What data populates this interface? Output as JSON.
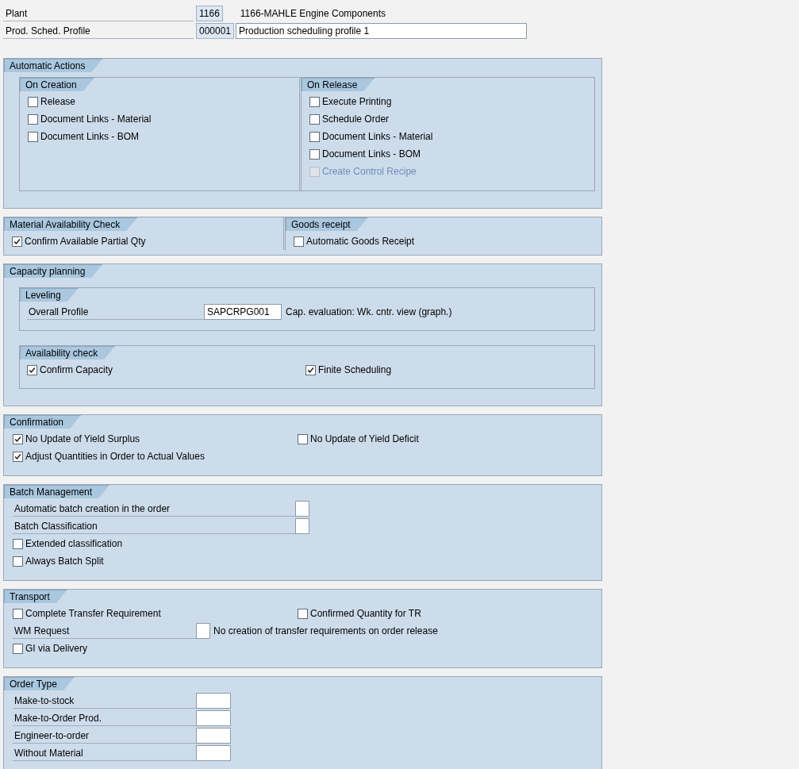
{
  "header": [
    {
      "label": "Plant",
      "value": "1166",
      "description": "1166-MAHLE Engine Components",
      "description_boxed": false
    },
    {
      "label": "Prod. Sched. Profile",
      "value": "000001",
      "description": "Production scheduling profile 1",
      "description_boxed": true
    }
  ],
  "sections": [
    {
      "title": "Automatic Actions",
      "body": [
        {
          "kind": "split",
          "panes": [
            {
              "title": "On Creation",
              "body": [
                {
                  "kind": "checkbox",
                  "label": "Release",
                  "checked": false,
                  "disabled": false
                },
                {
                  "kind": "checkbox",
                  "label": "Document Links - Material",
                  "checked": false,
                  "disabled": false
                },
                {
                  "kind": "checkbox",
                  "label": "Document Links - BOM",
                  "checked": false,
                  "disabled": false
                }
              ]
            },
            {
              "title": "On Release",
              "body": [
                {
                  "kind": "checkbox",
                  "label": "Execute Printing",
                  "checked": false,
                  "disabled": false
                },
                {
                  "kind": "checkbox",
                  "label": "Schedule Order",
                  "checked": false,
                  "disabled": false
                },
                {
                  "kind": "checkbox",
                  "label": "Document Links - Material",
                  "checked": false,
                  "disabled": false
                },
                {
                  "kind": "checkbox",
                  "label": "Document Links - BOM",
                  "checked": false,
                  "disabled": false
                },
                {
                  "kind": "checkbox",
                  "label": "Create Control Recipe",
                  "checked": false,
                  "disabled": true
                }
              ]
            }
          ]
        }
      ]
    },
    {
      "body": [
        {
          "kind": "split",
          "panes": [
            {
              "title": "Material Availability Check",
              "body": [
                {
                  "kind": "checkbox",
                  "label": "Confirm Available Partial Qty",
                  "checked": true,
                  "disabled": false
                }
              ]
            },
            {
              "title": "Goods receipt",
              "body": [
                {
                  "kind": "checkbox",
                  "label": "Automatic Goods Receipt",
                  "checked": false,
                  "disabled": false
                }
              ]
            }
          ]
        }
      ]
    },
    {
      "title": "Capacity planning",
      "body": [
        {
          "kind": "subgroup",
          "title": "Leveling",
          "body": [
            {
              "kind": "field",
              "label": "Overall Profile",
              "value": "SAPCRPG001",
              "description": "Cap. evaluation: Wk. cntr. view (graph.)"
            }
          ]
        },
        {
          "kind": "subgroup",
          "title": "Availability check",
          "body": [
            {
              "kind": "row",
              "items": [
                {
                  "kind": "checkbox",
                  "label": "Confirm Capacity",
                  "checked": true,
                  "disabled": false
                },
                {
                  "kind": "checkbox",
                  "label": "Finite Scheduling",
                  "checked": true,
                  "disabled": false
                }
              ]
            }
          ]
        }
      ]
    },
    {
      "title": "Confirmation",
      "body": [
        {
          "kind": "row",
          "items": [
            {
              "kind": "checkbox",
              "label": "No Update of Yield Surplus",
              "checked": true,
              "disabled": false
            },
            {
              "kind": "checkbox",
              "label": "No Update of Yield Deficit",
              "checked": false,
              "disabled": false
            }
          ]
        },
        {
          "kind": "checkbox",
          "label": "Adjust Quantities in Order to Actual Values",
          "checked": true,
          "disabled": false
        }
      ]
    },
    {
      "title": "Batch Management",
      "body": [
        {
          "kind": "indicator",
          "label": "Automatic batch creation in the order"
        },
        {
          "kind": "indicator",
          "label": "Batch Classification"
        },
        {
          "kind": "checkbox",
          "label": "Extended classification",
          "checked": false,
          "disabled": false
        },
        {
          "kind": "checkbox",
          "label": "Always Batch Split",
          "checked": false,
          "disabled": false
        }
      ]
    },
    {
      "title": "Transport",
      "body": [
        {
          "kind": "row",
          "items": [
            {
              "kind": "checkbox",
              "label": "Complete Transfer Requirement",
              "checked": false,
              "disabled": false
            },
            {
              "kind": "checkbox",
              "label": "Confirmed Quantity for TR",
              "checked": false,
              "disabled": false
            }
          ]
        },
        {
          "kind": "option-field",
          "label": "WM Request",
          "description": "No creation of transfer requirements on order release"
        },
        {
          "kind": "checkbox",
          "label": "GI via Delivery",
          "checked": false,
          "disabled": false
        }
      ]
    },
    {
      "title": "Order Type",
      "body": [
        {
          "kind": "field",
          "label": "Make-to-stock"
        },
        {
          "kind": "field",
          "label": "Make-to-Order Prod."
        },
        {
          "kind": "field",
          "label": "Engineer-to-order"
        },
        {
          "kind": "field",
          "label": "Without Material"
        }
      ]
    }
  ]
}
